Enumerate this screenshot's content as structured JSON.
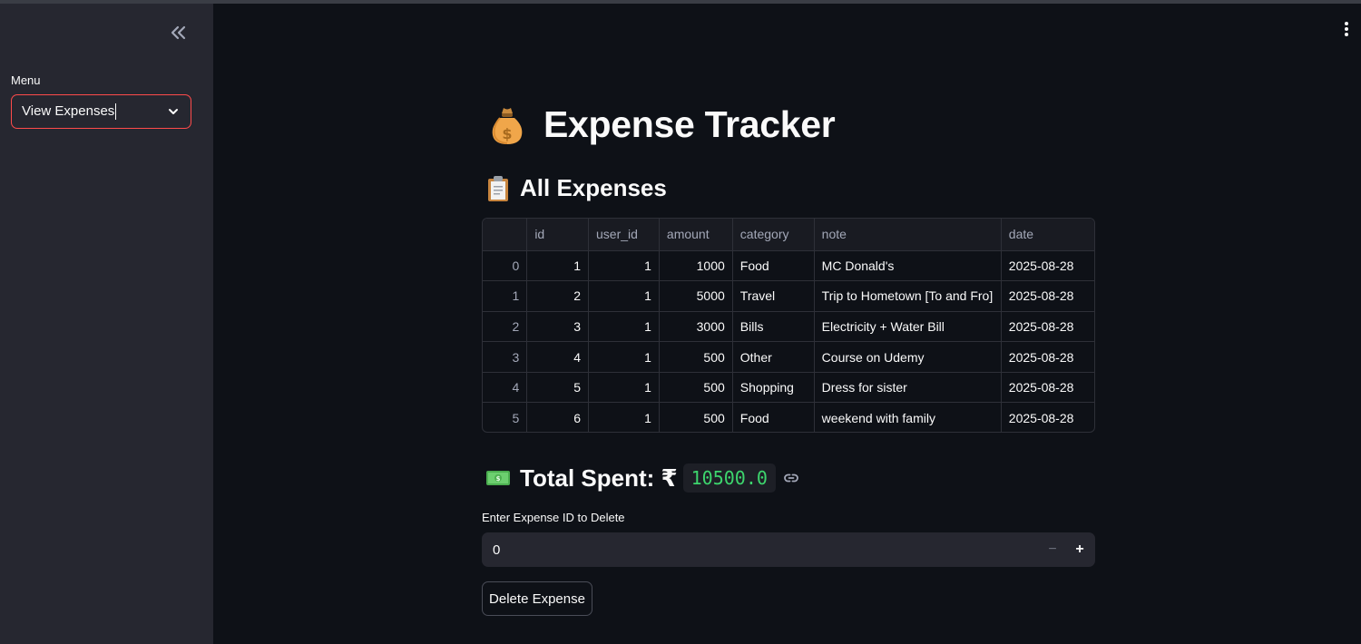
{
  "sidebar": {
    "menu_label": "Menu",
    "selected": "View Expenses"
  },
  "header": {
    "title": "Expense Tracker",
    "subtitle": "All Expenses"
  },
  "table": {
    "columns": [
      "",
      "id",
      "user_id",
      "amount",
      "category",
      "note",
      "date"
    ],
    "rows": [
      [
        "0",
        "1",
        "1",
        "1000",
        "Food",
        "MC Donald's",
        "2025-08-28"
      ],
      [
        "1",
        "2",
        "1",
        "5000",
        "Travel",
        "Trip to Hometown [To and Fro]",
        "2025-08-28"
      ],
      [
        "2",
        "3",
        "1",
        "3000",
        "Bills",
        "Electricity + Water Bill",
        "2025-08-28"
      ],
      [
        "3",
        "4",
        "1",
        "500",
        "Other",
        "Course on Udemy",
        "2025-08-28"
      ],
      [
        "4",
        "5",
        "1",
        "500",
        "Shopping",
        "Dress for sister",
        "2025-08-28"
      ],
      [
        "5",
        "6",
        "1",
        "500",
        "Food",
        "weekend with family",
        "2025-08-28"
      ]
    ]
  },
  "total": {
    "label": "Total Spent: ₹",
    "value": "10500.0"
  },
  "delete": {
    "label": "Enter Expense ID to Delete",
    "value": "0",
    "minus": "−",
    "plus": "+",
    "button": "Delete Expense"
  },
  "colors": {
    "accent": "#ff4b4b",
    "total_value": "#3dd56d"
  }
}
